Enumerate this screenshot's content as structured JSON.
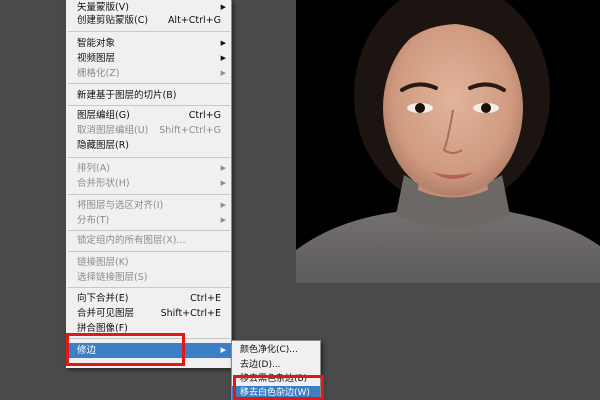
{
  "menu": {
    "items": [
      {
        "label": "矢量蒙版(V)",
        "shortcut": "",
        "arrow": true,
        "disabled": false
      },
      {
        "label": "创建剪贴蒙版(C)",
        "shortcut": "Alt+Ctrl+G",
        "arrow": false,
        "disabled": false
      },
      {
        "label": "智能对象",
        "shortcut": "",
        "arrow": true,
        "disabled": false
      },
      {
        "label": "视频图层",
        "shortcut": "",
        "arrow": true,
        "disabled": false
      },
      {
        "label": "栅格化(Z)",
        "shortcut": "",
        "arrow": true,
        "disabled": true
      },
      {
        "label": "新建基于图层的切片(B)",
        "shortcut": "",
        "arrow": false,
        "disabled": false
      },
      {
        "label": "图层编组(G)",
        "shortcut": "Ctrl+G",
        "arrow": false,
        "disabled": false
      },
      {
        "label": "取消图层编组(U)",
        "shortcut": "Shift+Ctrl+G",
        "arrow": false,
        "disabled": true
      },
      {
        "label": "隐藏图层(R)",
        "shortcut": "",
        "arrow": false,
        "disabled": false
      },
      {
        "label": "排列(A)",
        "shortcut": "",
        "arrow": true,
        "disabled": true
      },
      {
        "label": "合并形状(H)",
        "shortcut": "",
        "arrow": true,
        "disabled": true
      },
      {
        "label": "将图层与选区对齐(I)",
        "shortcut": "",
        "arrow": true,
        "disabled": true
      },
      {
        "label": "分布(T)",
        "shortcut": "",
        "arrow": true,
        "disabled": true
      },
      {
        "label": "锁定组内的所有图层(X)...",
        "shortcut": "",
        "arrow": false,
        "disabled": true
      },
      {
        "label": "链接图层(K)",
        "shortcut": "",
        "arrow": false,
        "disabled": true
      },
      {
        "label": "选择链接图层(S)",
        "shortcut": "",
        "arrow": false,
        "disabled": true
      },
      {
        "label": "向下合并(E)",
        "shortcut": "Ctrl+E",
        "arrow": false,
        "disabled": false
      },
      {
        "label": "合并可见图层",
        "shortcut": "Shift+Ctrl+E",
        "arrow": false,
        "disabled": false
      },
      {
        "label": "拼合图像(F)",
        "shortcut": "",
        "arrow": false,
        "disabled": false
      },
      {
        "label": "修边",
        "shortcut": "",
        "arrow": true,
        "disabled": false,
        "highlighted": true
      }
    ]
  },
  "submenu": {
    "items": [
      {
        "label": "颜色净化(C)...",
        "highlighted": false
      },
      {
        "label": "去边(D)...",
        "highlighted": false
      },
      {
        "label": "移去黑色杂边(B)",
        "highlighted": false
      },
      {
        "label": "移去白色杂边(W)",
        "highlighted": true
      }
    ]
  },
  "colors": {
    "menu_bg": "#f0f0f0",
    "highlight": "#3d7fc6",
    "annotation_red": "#e01818",
    "workspace_bg": "#4a4a4a"
  }
}
